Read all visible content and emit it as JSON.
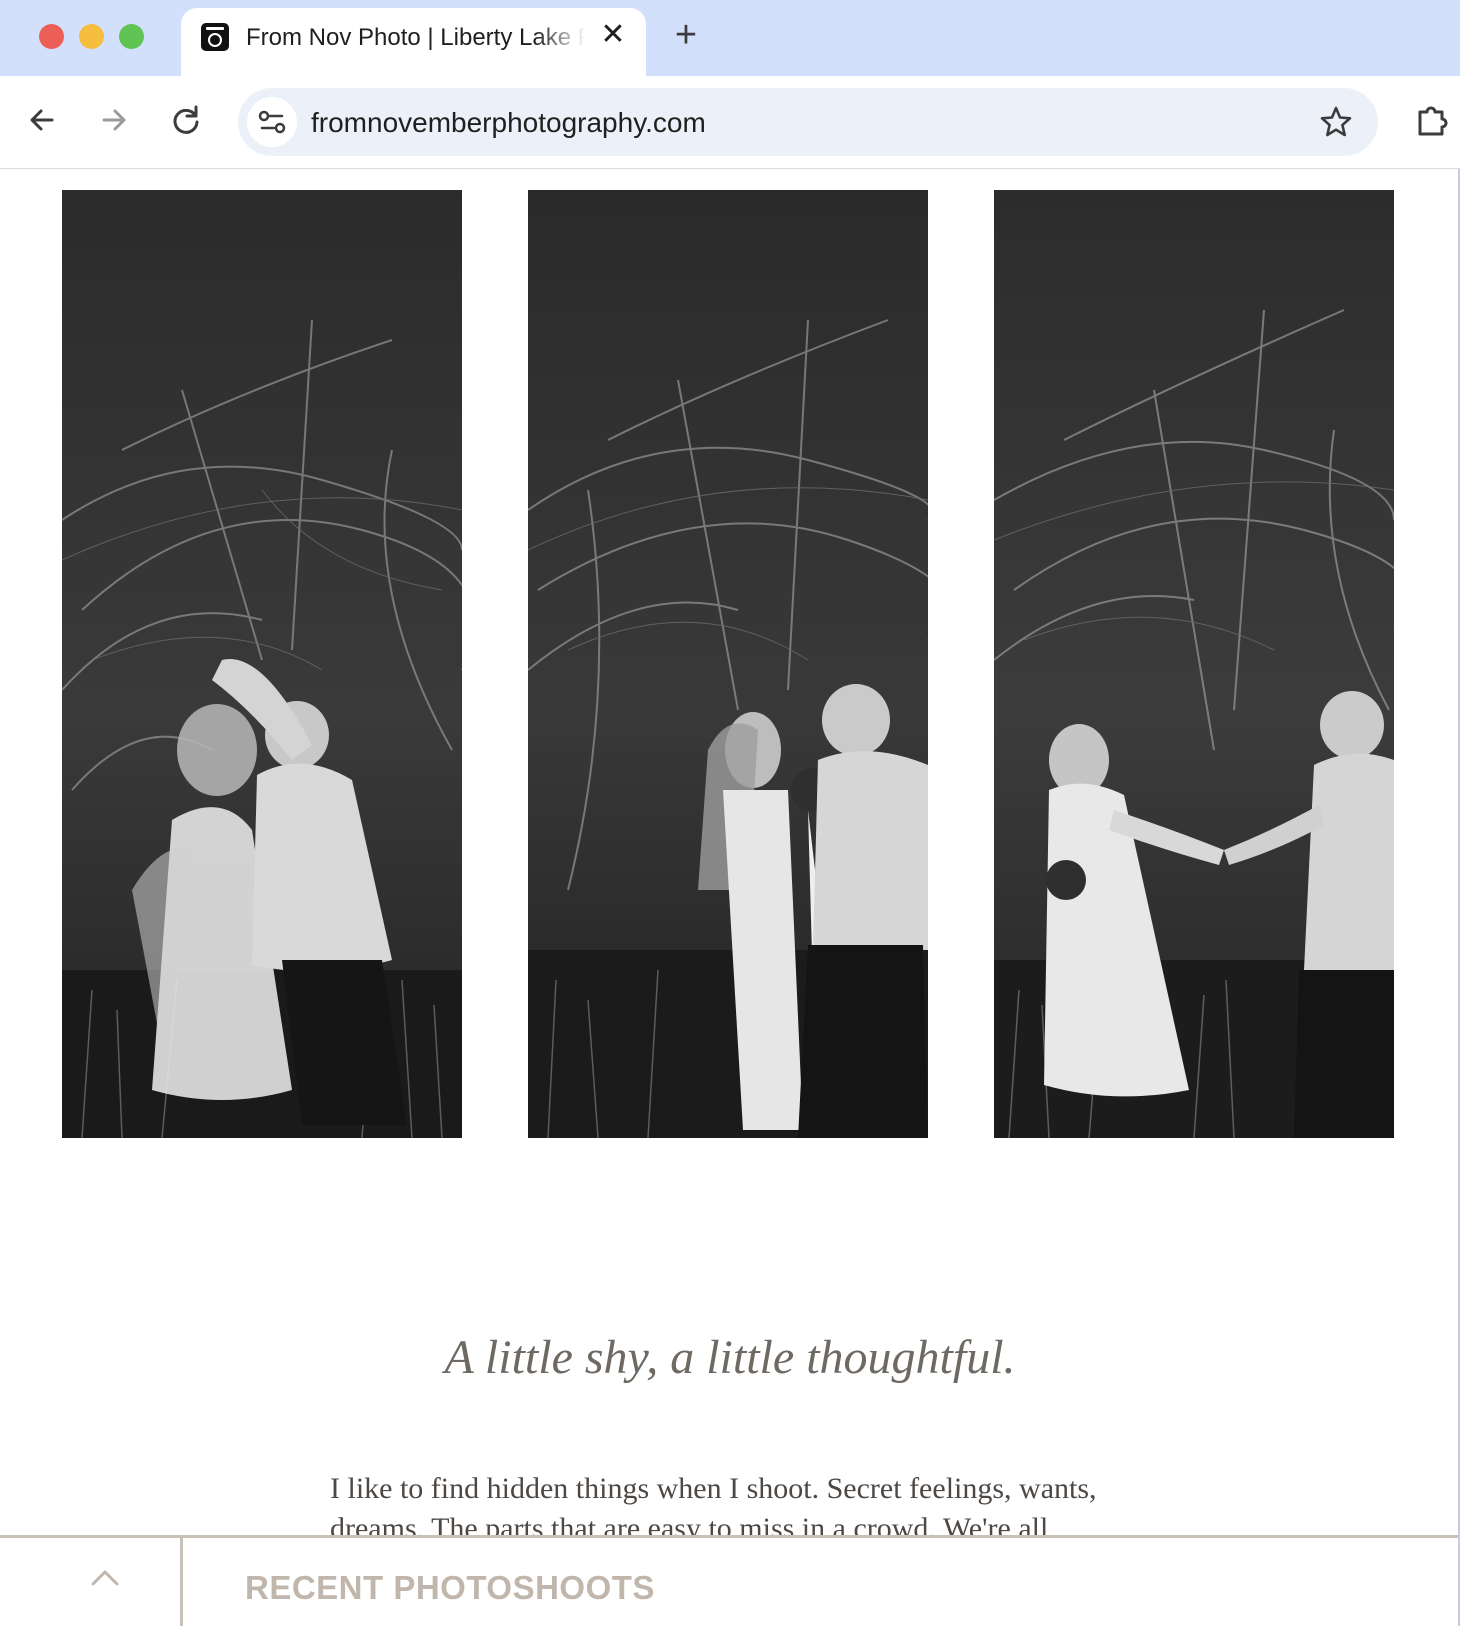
{
  "browser": {
    "tab": {
      "title": "From Nov Photo | Liberty Lake Photographer",
      "close_label": "✕"
    },
    "new_tab_label": "+",
    "address_bar": {
      "url": "fromnovemberphotography.com"
    },
    "icons": [
      "camera-favicon-icon",
      "back-arrow-icon",
      "forward-arrow-icon",
      "reload-icon",
      "site-info-icon",
      "bookmark-star-icon",
      "extensions-icon"
    ],
    "colors": {
      "tabstrip": "#d3e0fb",
      "omnibox": "#ecf0f9",
      "close_dot": "#ec5f57",
      "minimize_dot": "#f6be3e",
      "maximize_dot": "#5fc453"
    }
  },
  "gallery": {
    "photos": [
      {
        "alt": "Couple dancing among bare trees, black and white"
      },
      {
        "alt": "Couple embracing with bouquet in the woods, black and white"
      },
      {
        "alt": "Couple holding hands walking through tall grass, black and white"
      }
    ]
  },
  "story": {
    "heading": "A little shy, a little thoughtful.",
    "body": "I like to find hidden things when I shoot. Secret feelings, wants, dreams. The parts that are easy to miss in a crowd. We're all"
  },
  "footer": {
    "title": "RECENT PHOTOSHOOTS",
    "icons": [
      "chevron-up-icon"
    ],
    "colors": {
      "accent": "#c0b6ab",
      "divider": "#c9c1b8"
    }
  },
  "colors": {
    "heading_text": "#6f6964",
    "body_text": "#4d4844"
  }
}
